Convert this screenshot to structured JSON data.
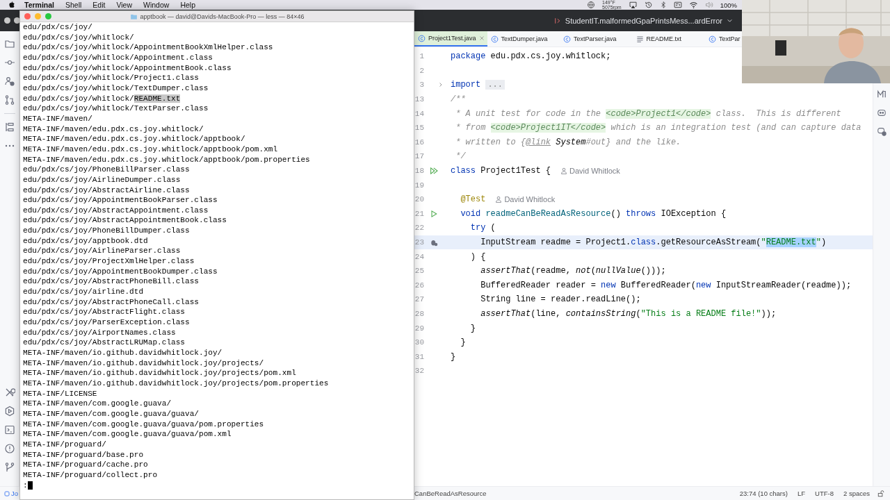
{
  "menu_bar": {
    "items": [
      {
        "label": "Terminal",
        "kind": "app"
      },
      {
        "label": "Shell",
        "kind": "menu"
      },
      {
        "label": "Edit",
        "kind": "menu"
      },
      {
        "label": "View",
        "kind": "menu"
      },
      {
        "label": "Window",
        "kind": "menu"
      },
      {
        "label": "Help",
        "kind": "menu"
      }
    ],
    "sensor": {
      "temperature": "149°F",
      "fan": "5075rpm"
    },
    "battery": "100%"
  },
  "terminal": {
    "title": "apptbook — david@Davids-MacBook-Pro — less — 84×46",
    "lines": [
      "edu/pdx/cs/joy/",
      "edu/pdx/cs/joy/whitlock/",
      "edu/pdx/cs/joy/whitlock/AppointmentBookXmlHelper.class",
      "edu/pdx/cs/joy/whitlock/Appointment.class",
      "edu/pdx/cs/joy/whitlock/AppointmentBook.class",
      "edu/pdx/cs/joy/whitlock/Project1.class",
      "edu/pdx/cs/joy/whitlock/TextDumper.class",
      {
        "segments": [
          {
            "text": "edu/pdx/cs/joy/whitlock/",
            "selected": false
          },
          {
            "text": "README.txt",
            "selected": true
          }
        ]
      },
      "edu/pdx/cs/joy/whitlock/TextParser.class",
      "META-INF/maven/",
      "META-INF/maven/edu.pdx.cs.joy.whitlock/",
      "META-INF/maven/edu.pdx.cs.joy.whitlock/apptbook/",
      "META-INF/maven/edu.pdx.cs.joy.whitlock/apptbook/pom.xml",
      "META-INF/maven/edu.pdx.cs.joy.whitlock/apptbook/pom.properties",
      "edu/pdx/cs/joy/PhoneBillParser.class",
      "edu/pdx/cs/joy/AirlineDumper.class",
      "edu/pdx/cs/joy/AbstractAirline.class",
      "edu/pdx/cs/joy/AppointmentBookParser.class",
      "edu/pdx/cs/joy/AbstractAppointment.class",
      "edu/pdx/cs/joy/AbstractAppointmentBook.class",
      "edu/pdx/cs/joy/PhoneBillDumper.class",
      "edu/pdx/cs/joy/apptbook.dtd",
      "edu/pdx/cs/joy/AirlineParser.class",
      "edu/pdx/cs/joy/ProjectXmlHelper.class",
      "edu/pdx/cs/joy/AppointmentBookDumper.class",
      "edu/pdx/cs/joy/AbstractPhoneBill.class",
      "edu/pdx/cs/joy/airline.dtd",
      "edu/pdx/cs/joy/AbstractPhoneCall.class",
      "edu/pdx/cs/joy/AbstractFlight.class",
      "edu/pdx/cs/joy/ParserException.class",
      "edu/pdx/cs/joy/AirportNames.class",
      "edu/pdx/cs/joy/AbstractLRUMap.class",
      "META-INF/maven/io.github.davidwhitlock.joy/",
      "META-INF/maven/io.github.davidwhitlock.joy/projects/",
      "META-INF/maven/io.github.davidwhitlock.joy/projects/pom.xml",
      "META-INF/maven/io.github.davidwhitlock.joy/projects/pom.properties",
      "META-INF/LICENSE",
      "META-INF/maven/com.google.guava/",
      "META-INF/maven/com.google.guava/guava/",
      "META-INF/maven/com.google.guava/guava/pom.properties",
      "META-INF/maven/com.google.guava/guava/pom.xml",
      "META-INF/proguard/",
      "META-INF/proguard/base.pro",
      "META-INF/proguard/cache.pro",
      "META-INF/proguard/collect.pro"
    ],
    "prompt": ":"
  },
  "ide": {
    "run_configuration": "StudentIT.malformedGpaPrintsMess...ardError",
    "tabs": [
      {
        "label": "Project1Test.java",
        "kind": "class",
        "selected": true
      },
      {
        "label": "TextDumper.java",
        "kind": "class",
        "selected": false
      },
      {
        "label": "TextParser.java",
        "kind": "class",
        "selected": false
      },
      {
        "label": "README.txt",
        "kind": "text",
        "selected": false
      },
      {
        "label": "TextPar",
        "kind": "class",
        "selected": false
      }
    ],
    "code": [
      {
        "number": "1",
        "kind": "code",
        "current": false,
        "tokens": [
          {
            "kind": "kw",
            "text": "package "
          },
          {
            "kind": "plain",
            "text": "edu.pdx.cs.joy.whitlock;"
          }
        ]
      },
      {
        "number": "2",
        "kind": "code",
        "current": false
      },
      {
        "number": "3",
        "kind": "folded",
        "current": false,
        "tokens": [
          {
            "kind": "kw",
            "text": "import "
          },
          {
            "kind": "fold",
            "text": "..."
          }
        ]
      },
      {
        "number": "13",
        "kind": "code",
        "current": false,
        "tokens": [
          {
            "kind": "comment",
            "text": "/**"
          }
        ]
      },
      {
        "number": "14",
        "kind": "code",
        "current": false,
        "tokens": [
          {
            "kind": "comment",
            "text": " * A unit test for code in the "
          },
          {
            "kind": "doc",
            "text": "<code>Project1</code>"
          },
          {
            "kind": "comment",
            "text": " class.  This is different"
          }
        ]
      },
      {
        "number": "15",
        "kind": "code",
        "current": false,
        "tokens": [
          {
            "kind": "comment",
            "text": " * from "
          },
          {
            "kind": "doc",
            "text": "<code>Project1IT</code>"
          },
          {
            "kind": "comment",
            "text": " which is an integration test (and can capture data"
          }
        ]
      },
      {
        "number": "16",
        "kind": "code",
        "current": false,
        "tokens": [
          {
            "kind": "comment",
            "text": " * written to {"
          },
          {
            "kind": "doclink",
            "text": "@link"
          },
          {
            "kind": "docref",
            "text": " System"
          },
          {
            "kind": "comment",
            "text": "#out} and the like."
          }
        ]
      },
      {
        "number": "17",
        "kind": "code",
        "current": false,
        "tokens": [
          {
            "kind": "comment",
            "text": " */"
          }
        ]
      },
      {
        "number": "18",
        "kind": "runnable-class",
        "current": false,
        "author": "David Whitlock",
        "tokens": [
          {
            "kind": "kw",
            "text": "class "
          },
          {
            "kind": "plain",
            "text": "Project1Test {"
          }
        ]
      },
      {
        "number": "19",
        "kind": "code",
        "current": false
      },
      {
        "number": "20",
        "kind": "code",
        "current": false,
        "author": "David Whitlock",
        "tokens": [
          {
            "kind": "ann",
            "text": "  @Test"
          }
        ]
      },
      {
        "number": "21",
        "kind": "runnable-method",
        "current": false,
        "tokens": [
          {
            "kind": "kw",
            "text": "  void "
          },
          {
            "kind": "decl",
            "text": "readmeCanBeReadAsResource"
          },
          {
            "kind": "plain",
            "text": "() "
          },
          {
            "kind": "kw",
            "text": "throws "
          },
          {
            "kind": "plain",
            "text": "IOException {"
          }
        ]
      },
      {
        "number": "22",
        "kind": "code",
        "current": false,
        "tokens": [
          {
            "kind": "kw",
            "text": "    try"
          },
          {
            "kind": "plain",
            "text": " ("
          }
        ]
      },
      {
        "number": "23",
        "kind": "breakpoint",
        "current": true,
        "tokens": [
          {
            "kind": "plain",
            "text": "      InputStream readme = Project1."
          },
          {
            "kind": "kw",
            "text": "class"
          },
          {
            "kind": "plain",
            "text": ".getResourceAsStream("
          },
          {
            "kind": "str",
            "text": "\""
          },
          {
            "kind": "sel",
            "text": "README.txt"
          },
          {
            "kind": "str",
            "text": "\""
          },
          {
            "kind": "plain",
            "text": ")"
          }
        ]
      },
      {
        "number": "24",
        "kind": "code",
        "current": false,
        "tokens": [
          {
            "kind": "plain",
            "text": "    ) {"
          }
        ]
      },
      {
        "number": "25",
        "kind": "code",
        "current": false,
        "tokens": [
          {
            "kind": "call",
            "text": "      assertThat"
          },
          {
            "kind": "plain",
            "text": "(readme, "
          },
          {
            "kind": "call",
            "text": "not"
          },
          {
            "kind": "plain",
            "text": "("
          },
          {
            "kind": "call",
            "text": "nullValue"
          },
          {
            "kind": "plain",
            "text": "()));"
          }
        ]
      },
      {
        "number": "26",
        "kind": "code",
        "current": false,
        "tokens": [
          {
            "kind": "plain",
            "text": "      BufferedReader reader = "
          },
          {
            "kind": "kw",
            "text": "new"
          },
          {
            "kind": "plain",
            "text": " BufferedReader("
          },
          {
            "kind": "kw",
            "text": "new"
          },
          {
            "kind": "plain",
            "text": " InputStreamReader(readme));"
          }
        ]
      },
      {
        "number": "27",
        "kind": "code",
        "current": false,
        "tokens": [
          {
            "kind": "plain",
            "text": "      String line = reader.readLine();"
          }
        ]
      },
      {
        "number": "28",
        "kind": "code",
        "current": false,
        "tokens": [
          {
            "kind": "call",
            "text": "      assertThat"
          },
          {
            "kind": "plain",
            "text": "(line, "
          },
          {
            "kind": "call",
            "text": "containsString"
          },
          {
            "kind": "plain",
            "text": "("
          },
          {
            "kind": "str",
            "text": "\"This is a README file!\""
          },
          {
            "kind": "plain",
            "text": "));"
          }
        ]
      },
      {
        "number": "29",
        "kind": "code",
        "current": false,
        "tokens": [
          {
            "kind": "plain",
            "text": "    }"
          }
        ]
      },
      {
        "number": "30",
        "kind": "code",
        "current": false,
        "tokens": [
          {
            "kind": "plain",
            "text": "  }"
          }
        ]
      },
      {
        "number": "31",
        "kind": "code",
        "current": false,
        "tokens": [
          {
            "kind": "plain",
            "text": "}"
          }
        ]
      },
      {
        "number": "32",
        "kind": "code",
        "current": false
      }
    ],
    "status_bar": {
      "project": "Jo",
      "breadcrumb": "CanBeReadAsResource",
      "position": "23:74 (10 chars)",
      "line_separator": "LF",
      "encoding": "UTF-8",
      "indent": "2 spaces"
    }
  }
}
